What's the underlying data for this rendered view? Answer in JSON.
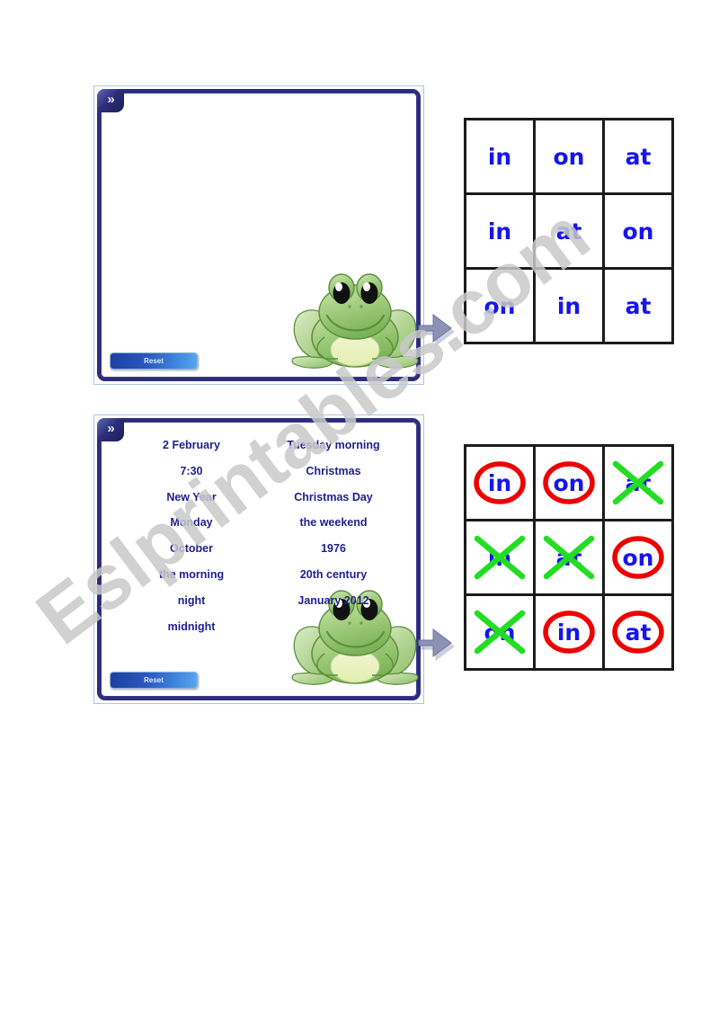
{
  "page": {
    "background_color": "#ffffff",
    "watermark_text": "Eslprintables.com",
    "watermark_color": "#c9c9c9"
  },
  "colors": {
    "panel_border_dark": "#2c2c7a",
    "panel_border_light": "#a9c6e6",
    "word_text": "#1f1f8e",
    "grid_word_text": "#1515ee",
    "grid_line": "#1b1b1b",
    "circle_mark": "#ee0000",
    "cross_mark": "#22dd22",
    "frog_green": "#8cc26a",
    "arrow_grey": "#8b92b4"
  },
  "panels": [
    {
      "id": "panel-empty",
      "chevron_label": "»",
      "reset_label": "Reset",
      "columns": [],
      "has_frog": true
    },
    {
      "id": "panel-filled",
      "chevron_label": "»",
      "reset_label": "Reset",
      "columns": [
        {
          "name": "left-column",
          "words": [
            "2 February",
            "7:30",
            "New Year",
            "Monday",
            "October",
            "the morning",
            "night",
            "midnight"
          ]
        },
        {
          "name": "right-column",
          "words": [
            "Tuesday morning",
            "Christmas",
            "Christmas Day",
            "the weekend",
            "1976",
            "20th century",
            "January 2012"
          ]
        }
      ],
      "has_frog": true
    }
  ],
  "grids": [
    {
      "id": "grid-unmarked",
      "rows": [
        [
          {
            "word": "in",
            "mark": "none"
          },
          {
            "word": "on",
            "mark": "none"
          },
          {
            "word": "at",
            "mark": "none"
          }
        ],
        [
          {
            "word": "in",
            "mark": "none"
          },
          {
            "word": "at",
            "mark": "none"
          },
          {
            "word": "on",
            "mark": "none"
          }
        ],
        [
          {
            "word": "on",
            "mark": "none"
          },
          {
            "word": "in",
            "mark": "none"
          },
          {
            "word": "at",
            "mark": "none"
          }
        ]
      ]
    },
    {
      "id": "grid-marked",
      "rows": [
        [
          {
            "word": "in",
            "mark": "circle"
          },
          {
            "word": "on",
            "mark": "circle"
          },
          {
            "word": "at",
            "mark": "cross"
          }
        ],
        [
          {
            "word": "in",
            "mark": "cross"
          },
          {
            "word": "at",
            "mark": "cross"
          },
          {
            "word": "on",
            "mark": "circle"
          }
        ],
        [
          {
            "word": "on",
            "mark": "cross"
          },
          {
            "word": "in",
            "mark": "circle"
          },
          {
            "word": "at",
            "mark": "circle"
          }
        ]
      ]
    }
  ],
  "arrows": [
    {
      "id": "arrow-top",
      "direction": "right"
    },
    {
      "id": "arrow-bottom",
      "direction": "right"
    }
  ]
}
